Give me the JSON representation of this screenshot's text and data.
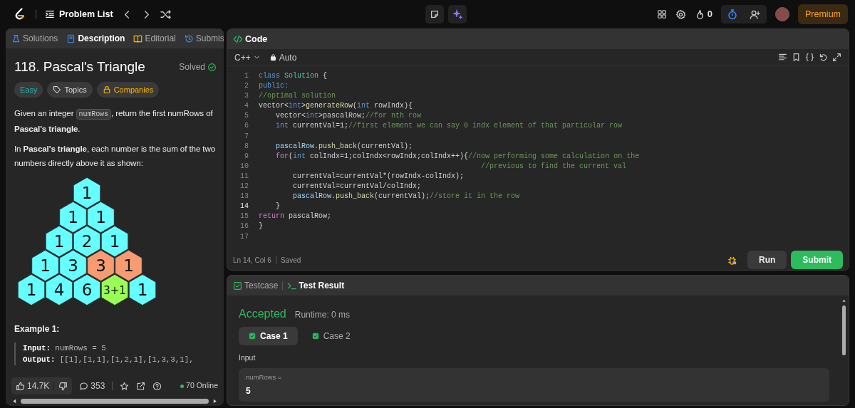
{
  "topbar": {
    "title": "Problem List",
    "streak": "0",
    "premium": "Premium"
  },
  "description_tabs": [
    {
      "label": "Solutions",
      "kind": "solutions",
      "selected": false
    },
    {
      "label": "Description",
      "kind": "description",
      "selected": true
    },
    {
      "label": "Editorial",
      "kind": "editorial",
      "selected": false
    },
    {
      "label": "Submis",
      "kind": "submissions",
      "selected": false
    }
  ],
  "problem": {
    "title": "118. Pascal's Triangle",
    "status": "Solved",
    "tags": [
      {
        "label": "Easy",
        "kind": "difficulty"
      },
      {
        "label": "Topics",
        "kind": "topics"
      },
      {
        "label": "Companies",
        "kind": "companies"
      }
    ],
    "intro": {
      "before": "Given an integer ",
      "code": "numRows",
      "after": ", return the first numRows of **Pascal's triangle**."
    },
    "paragraph": "In **Pascal's triangle**, each number is the sum of the two numbers directly above it as shown:",
    "triangle": [
      [
        {
          "text": "1",
          "color": "#66ffff"
        }
      ],
      [
        {
          "text": "1",
          "color": "#66ffff"
        },
        {
          "text": "1",
          "color": "#66ffff"
        }
      ],
      [
        {
          "text": "1",
          "color": "#66ffff"
        },
        {
          "text": "2",
          "color": "#66ffff"
        },
        {
          "text": "1",
          "color": "#66ffff"
        }
      ],
      [
        {
          "text": "1",
          "color": "#66ffff"
        },
        {
          "text": "3",
          "color": "#66ffff"
        },
        {
          "text": "3",
          "color": "#f79c72"
        },
        {
          "text": "1",
          "color": "#f79c72"
        }
      ],
      [
        {
          "text": "1",
          "color": "#66ffff"
        },
        {
          "text": "4",
          "color": "#66ffff"
        },
        {
          "text": "6",
          "color": "#66ffff"
        },
        {
          "text": "3+1",
          "color": "#99ff55"
        },
        {
          "text": "1",
          "color": "#66ffff"
        }
      ]
    ],
    "example": {
      "heading": "Example 1:",
      "lines": [
        {
          "label": "Input:",
          "value": "numRows = 5"
        },
        {
          "label": "Output:",
          "value": "[[1],[1,1],[1,2,1],[1,3,3,1],"
        }
      ]
    }
  },
  "stats": {
    "likes": "14.7K",
    "comments": "353",
    "online": "70 Online"
  },
  "editor": {
    "title": "Code",
    "language": "C++",
    "mode": "Auto",
    "lines": [
      {
        "number": "1",
        "active": false,
        "tokens": [
          {
            "text": "class ",
            "kind": "kw"
          },
          {
            "text": "Solution",
            "kind": "type"
          },
          {
            "text": " {",
            "kind": "pl"
          }
        ]
      },
      {
        "number": "2",
        "active": false,
        "tokens": [
          {
            "text": "public:",
            "kind": "kw"
          }
        ]
      },
      {
        "number": "3",
        "active": false,
        "tokens": [
          {
            "text": "//optimal solution",
            "kind": "cm"
          }
        ]
      },
      {
        "number": "4",
        "active": false,
        "tokens": [
          {
            "text": "vector<",
            "kind": "pl"
          },
          {
            "text": "int",
            "kind": "kw"
          },
          {
            "text": ">",
            "kind": "pl"
          },
          {
            "text": "generateRow",
            "kind": "fn"
          },
          {
            "text": "(",
            "kind": "pl"
          },
          {
            "text": "int",
            "kind": "kw"
          },
          {
            "text": " rowIndx){",
            "kind": "pl"
          }
        ]
      },
      {
        "number": "5",
        "active": false,
        "tokens": [
          {
            "text": "    vector<",
            "kind": "pl"
          },
          {
            "text": "int",
            "kind": "kw"
          },
          {
            "text": ">pascalRow;",
            "kind": "pl"
          },
          {
            "text": "//for nth row",
            "kind": "cm"
          }
        ]
      },
      {
        "number": "6",
        "active": false,
        "tokens": [
          {
            "text": "    int",
            "kind": "kw"
          },
          {
            "text": " currentVal=1;",
            "kind": "pl"
          },
          {
            "text": "//first element we can say 0 indx element of that particular row",
            "kind": "cm"
          }
        ]
      },
      {
        "number": "7",
        "active": false
      },
      {
        "number": "8",
        "active": false,
        "tokens": [
          {
            "text": "    pascalRow",
            "kind": "var"
          },
          {
            "text": ".",
            "kind": "pl"
          },
          {
            "text": "push_back",
            "kind": "fn"
          },
          {
            "text": "(currentVal);",
            "kind": "pl"
          }
        ]
      },
      {
        "number": "9",
        "active": false,
        "tokens": [
          {
            "text": "    for",
            "kind": "ctl"
          },
          {
            "text": "(",
            "kind": "pl"
          },
          {
            "text": "int",
            "kind": "kw"
          },
          {
            "text": " colIndx=1;colIndx<rowIndx;colIndx++){",
            "kind": "pl"
          },
          {
            "text": "//now performing some calculation on the",
            "kind": "cm"
          }
        ]
      },
      {
        "number": "10",
        "active": false,
        "tokens": [
          {
            "text": "                                                    //previous to find the current val",
            "kind": "cm"
          }
        ]
      },
      {
        "number": "11",
        "active": false,
        "tokens": [
          {
            "text": "        currentVal=currentVal*(rowIndx-colIndx);",
            "kind": "pl"
          }
        ]
      },
      {
        "number": "12",
        "active": false,
        "tokens": [
          {
            "text": "        currentVal=currentVal/colIndx;",
            "kind": "pl"
          }
        ]
      },
      {
        "number": "13",
        "active": false,
        "tokens": [
          {
            "text": "        pascalRow",
            "kind": "var"
          },
          {
            "text": ".",
            "kind": "pl"
          },
          {
            "text": "push_back",
            "kind": "fn"
          },
          {
            "text": "(currentVal);",
            "kind": "pl"
          },
          {
            "text": "//store it in the row",
            "kind": "cm"
          }
        ]
      },
      {
        "number": "14",
        "active": true,
        "tokens": [
          {
            "text": "    }",
            "kind": "pl"
          }
        ]
      },
      {
        "number": "15",
        "active": false,
        "tokens": [
          {
            "text": "return",
            "kind": "ctl"
          },
          {
            "text": " pascalRow;",
            "kind": "pl"
          }
        ]
      },
      {
        "number": "16",
        "active": false,
        "tokens": [
          {
            "text": "}",
            "kind": "pl"
          }
        ]
      },
      {
        "number": "17",
        "active": false
      }
    ],
    "cursor": "Ln 14, Col 6",
    "save_state": "Saved",
    "run": "Run",
    "submit": "Submit"
  },
  "results": {
    "tabs": [
      {
        "label": "Testcase",
        "kind": "testcase",
        "selected": false
      },
      {
        "label": "Test Result",
        "kind": "result",
        "selected": true
      }
    ],
    "verdict": "Accepted",
    "runtime": "Runtime: 0 ms",
    "cases": [
      {
        "label": "Case 1",
        "selected": true,
        "passed": true
      },
      {
        "label": "Case 2",
        "selected": false,
        "passed": true
      }
    ],
    "input_label": "Input",
    "params": [
      {
        "name": "numRows =",
        "value": "5"
      }
    ]
  }
}
